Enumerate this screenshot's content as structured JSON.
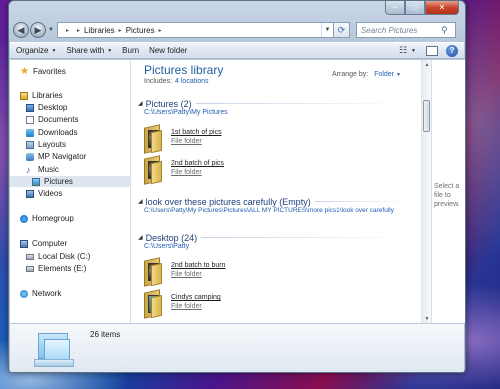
{
  "window": {
    "caption": {
      "minimize": "–",
      "maximize": "□",
      "close": "✕"
    }
  },
  "address": {
    "back_icon": "back-arrow-icon",
    "forward_icon": "forward-arrow-icon",
    "crumbs": [
      "Libraries",
      "Pictures"
    ],
    "search_placeholder": "Search Pictures"
  },
  "toolbar": {
    "organize": "Organize",
    "share_with": "Share with",
    "burn": "Burn",
    "new_folder": "New folder"
  },
  "nav": {
    "favorites": "Favorites",
    "libraries": "Libraries",
    "library_items": [
      "Desktop",
      "Documents",
      "Downloads",
      "Layouts",
      "MP Navigator",
      "Music",
      "Pictures",
      "Videos"
    ],
    "selected": "Pictures",
    "homegroup": "Homegroup",
    "computer": "Computer",
    "drives": [
      "Local Disk (C:)",
      "Elements (E:)"
    ],
    "network": "Network"
  },
  "library": {
    "title": "Pictures library",
    "includes_label": "Includes:",
    "includes_link": "4 locations",
    "arrange_label": "Arrange by:",
    "arrange_value": "Folder"
  },
  "groups": [
    {
      "header": "Pictures (2)",
      "path": "C:\\Users\\Patty\\My Pictures",
      "items": [
        {
          "name": "1st batch of pics",
          "type": "File folder"
        },
        {
          "name": "2nd batch of pics",
          "type": "File folder"
        }
      ]
    },
    {
      "header": "look over these pictures carefully (Empty)",
      "path": "C:\\Users\\Patty\\My Pictures\\Pictures\\ALL MY PICTURES\\more pics1\\look over carefully",
      "items": []
    },
    {
      "header": "Desktop (24)",
      "path": "C:\\Users\\Patty",
      "items": [
        {
          "name": "2nd batch to burn",
          "type": "File folder"
        },
        {
          "name": "Cindys camping",
          "type": "File folder"
        }
      ]
    }
  ],
  "preview": {
    "message": "Select a file to preview."
  },
  "details": {
    "count": "26 items"
  }
}
